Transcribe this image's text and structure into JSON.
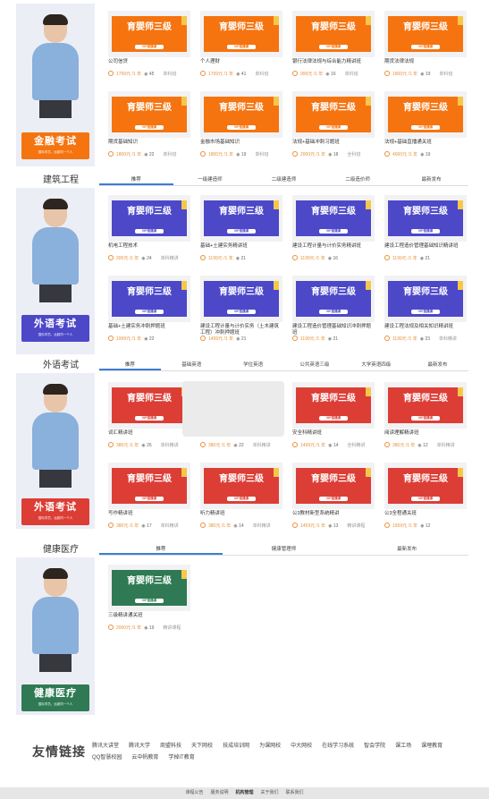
{
  "colors": {
    "finance": "#f57410",
    "construction": "#4c48c8",
    "language": "#dc3e36",
    "health": "#2f7a54",
    "tab_active": "#3b7fd4",
    "price": "#e8913a"
  },
  "banner": {
    "title": "育婴师三级",
    "pill": "VIP直播课"
  },
  "sections": [
    {
      "key": "finance",
      "title": "",
      "tabs": [],
      "badge": {
        "title": "金融考试",
        "subtitle": "国际学员，远超同一个人"
      },
      "courses": [
        {
          "name": "公司信贷",
          "price": "1799元 /1 年",
          "views": "45",
          "type": "单科班"
        },
        {
          "name": "个人理财",
          "price": "1799元 /1 年",
          "views": "41",
          "type": "单科班"
        },
        {
          "name": "银行法律法规与综合能力精讲班",
          "price": "999元 /1 年",
          "views": "16",
          "type": "单科班"
        },
        {
          "name": "期货法律法规",
          "price": "1800元 /1 年",
          "views": "19",
          "type": "单科班"
        },
        {
          "name": "期货基础知识",
          "price": "1800元 /1 年",
          "views": "22",
          "type": "单科班"
        },
        {
          "name": "金融市场基础知识",
          "price": "1800元 /1 年",
          "views": "19",
          "type": "单科班"
        },
        {
          "name": "法规+基础冲刺习题班",
          "price": "2000元 /1 年",
          "views": "18",
          "type": "全科班"
        },
        {
          "name": "法规+基础直播通关班",
          "price": "4000元 /1 年",
          "views": "19",
          "type": ""
        }
      ]
    },
    {
      "key": "construction",
      "title": "建筑工程",
      "tabs": [
        "推荐",
        "一级建造师",
        "二级建造师",
        "二级造价师",
        "最新发布"
      ],
      "badge": {
        "title": "外语考试",
        "subtitle": "国际学员，远超同一个人"
      },
      "courses": [
        {
          "name": "机电工程技术",
          "price": "300元 /1 年",
          "views": "24",
          "type": "单科精讲"
        },
        {
          "name": "基础+土建实务精讲班",
          "price": "1199元 /1 年",
          "views": "21",
          "type": ""
        },
        {
          "name": "建设工程计量与计价实务精讲班",
          "price": "1199元 /1 年",
          "views": "16",
          "type": ""
        },
        {
          "name": "建设工程造价管理基础知识精讲班",
          "price": "1199元 /1 年",
          "views": "21",
          "type": ""
        },
        {
          "name": "基础+土建实务冲刺押题班",
          "price": "1999元 /1 年",
          "views": "22",
          "type": ""
        },
        {
          "name": "建设工程计量与计价实务（土木建筑工程）冲刺押题班",
          "price": "1499元 /1 年",
          "views": "21",
          "type": ""
        },
        {
          "name": "建设工程造价管理基础知识冲刺押题班",
          "price": "1199元 /1 年",
          "views": "21",
          "type": ""
        },
        {
          "name": "建设工程法规及相关知识精讲班",
          "price": "1199元 /1 年",
          "views": "23",
          "type": "单科精讲"
        }
      ]
    },
    {
      "key": "language",
      "title": "外语考试",
      "tabs": [
        "推荐",
        "基础英语",
        "学位英语",
        "公共英语三级",
        "大学英语四级",
        "最新发布"
      ],
      "badge": {
        "title": "外语考试",
        "subtitle": "国际学员，远超同一个人"
      },
      "courses": [
        {
          "name": "词汇精讲班",
          "price": "380元 /1 年",
          "views": "26",
          "type": "单科精讲"
        },
        {
          "name": "",
          "price": "380元 /1 年",
          "views": "22",
          "type": "单科精讲"
        },
        {
          "name": "安全科精讲班",
          "price": "1499元 /1 年",
          "views": "14",
          "type": "全科精讲"
        },
        {
          "name": "阅读理解精讲班",
          "price": "380元 /1 年",
          "views": "12",
          "type": "单科精讲"
        },
        {
          "name": "写作精讲班",
          "price": "380元 /1 年",
          "views": "17",
          "type": "单科精讲"
        },
        {
          "name": "听力精讲班",
          "price": "380元 /1 年",
          "views": "14",
          "type": "单科精讲"
        },
        {
          "name": "公3教材新型系统精讲",
          "price": "1459元 /1 年",
          "views": "13",
          "type": "精讲课程"
        },
        {
          "name": "公3全程通关班",
          "price": "1959元 /1 年",
          "views": "12",
          "type": ""
        }
      ]
    },
    {
      "key": "health",
      "title": "健康医疗",
      "tabs": [
        "推荐",
        "健康管理师",
        "最新发布"
      ],
      "badge": {
        "title": "健康医疗",
        "subtitle": "国际学员，远超同一个人"
      },
      "courses": [
        {
          "name": "三级精讲通关班",
          "price": "2000元 /1 年",
          "views": "19",
          "type": "精讲课程"
        }
      ]
    }
  ],
  "friends": {
    "title": "友情链接",
    "links": [
      "腾讯大讲堂",
      "腾讯大学",
      "商盟科技",
      "天下网校",
      "技成培训网",
      "为课网校",
      "中大网校",
      "在线学习系统",
      "智会学院",
      "课工场",
      "课埋教育",
      "QQ智慧校园",
      "云中帆教育",
      "学掉IT教育"
    ]
  },
  "footer": {
    "links": [
      "课程公告",
      "服务说明",
      "机构管理",
      "关于我们",
      "联系我们"
    ]
  }
}
